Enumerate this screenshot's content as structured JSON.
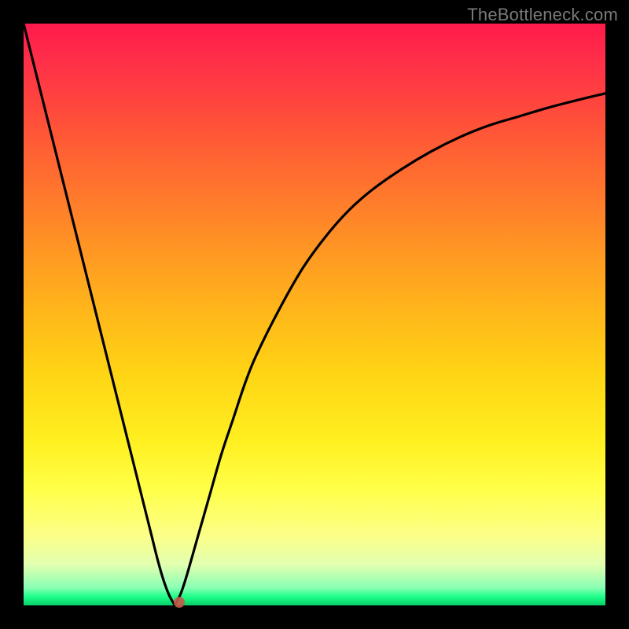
{
  "watermark": "TheBottleneck.com",
  "chart_data": {
    "type": "line",
    "title": "",
    "xlabel": "",
    "ylabel": "",
    "xlim": [
      0,
      100
    ],
    "ylim": [
      0,
      100
    ],
    "grid": false,
    "legend": false,
    "series": [
      {
        "name": "bottleneck-curve-left",
        "x": [
          0,
          2,
          4,
          6,
          8,
          10,
          12,
          14,
          16,
          18,
          20,
          21,
          22,
          23,
          24,
          25,
          26
        ],
        "y": [
          100,
          92,
          84,
          76,
          68,
          60,
          52,
          44,
          36,
          28,
          20,
          16,
          12,
          8,
          4.5,
          1.8,
          0
        ]
      },
      {
        "name": "bottleneck-curve-right",
        "x": [
          26,
          27,
          28,
          30,
          32,
          34,
          36,
          38,
          40,
          44,
          48,
          52,
          56,
          60,
          65,
          70,
          75,
          80,
          85,
          90,
          95,
          100
        ],
        "y": [
          0,
          2,
          5,
          12,
          19,
          26,
          32,
          38,
          43,
          51,
          58,
          63.5,
          68,
          71.5,
          75,
          78,
          80.5,
          82.5,
          84,
          85.5,
          86.8,
          88
        ]
      }
    ],
    "marker": {
      "x": 26.7,
      "y": 0.5,
      "name": "optimal-point"
    },
    "colors": {
      "curve": "#000000",
      "marker": "#c85a4a",
      "gradient_top": "#ff1a4b",
      "gradient_bottom": "#07d06a"
    }
  }
}
